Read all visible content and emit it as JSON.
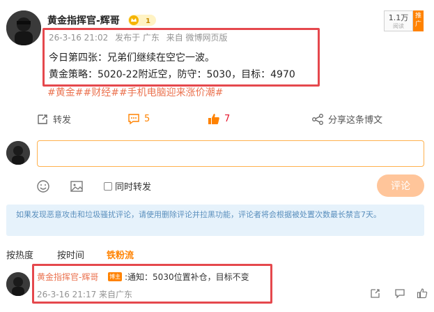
{
  "post": {
    "author": "黄金指挥官-辉哥",
    "vip_level": "1",
    "read_count": "1.1万",
    "read_label": "阅读",
    "push_tag": "推广",
    "date": "26-3-16 21:02",
    "posted_from": "发布于 广东",
    "source": "来自 微博网页版",
    "line1": "今日第四张：兄弟们继续在空它一波。",
    "line2": "黄金策略：5020-22附近空，防守：5030，目标：4970",
    "hashtags": [
      "#黄金#",
      "#财经#",
      "#手机电脑迎来涨价潮#"
    ]
  },
  "actions": {
    "repost_label": "转发",
    "comment_count": "5",
    "like_count": "7",
    "share_label": "分享这条博文"
  },
  "composer": {
    "placeholder": "",
    "repost_label": "同时转发",
    "submit_label": "评论"
  },
  "notice": "如果发现恶意攻击和垃圾骚扰评论，请使用删除评论并拉黑功能，评论者将会根据被处置次数最长禁言7天。",
  "sort_tabs": [
    "按热度",
    "按时间",
    "铁粉流"
  ],
  "comments": [
    {
      "author": "黄金指挥官-辉哥",
      "badge": "博主",
      "text": ":通知：5030位置补仓，目标不变",
      "meta": "26-3-16 21:17 来自广东"
    }
  ],
  "colors": {
    "accent": "#ff8200",
    "topic": "#eb7350",
    "highlight_frame": "#e5484d",
    "notice_bg": "#e6f2fb"
  }
}
